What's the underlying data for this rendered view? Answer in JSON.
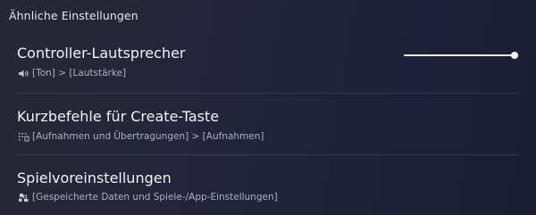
{
  "header": {
    "title": "Ähnliche Einstellungen"
  },
  "items": [
    {
      "title": "Controller-Lautsprecher",
      "icon": "speaker-icon",
      "path": "[Ton] > [Lautstärke]",
      "slider": {
        "value": 1.0
      }
    },
    {
      "title": "Kurzbefehle für Create-Taste",
      "icon": "capture-icon",
      "path": "[Aufnahmen und Übertragungen] > [Aufnahmen]"
    },
    {
      "title": "Spielvoreinstellungen",
      "icon": "saved-data-icon",
      "path": "[Gespeicherte Daten und Spiele-/App-Einstellungen]"
    }
  ]
}
